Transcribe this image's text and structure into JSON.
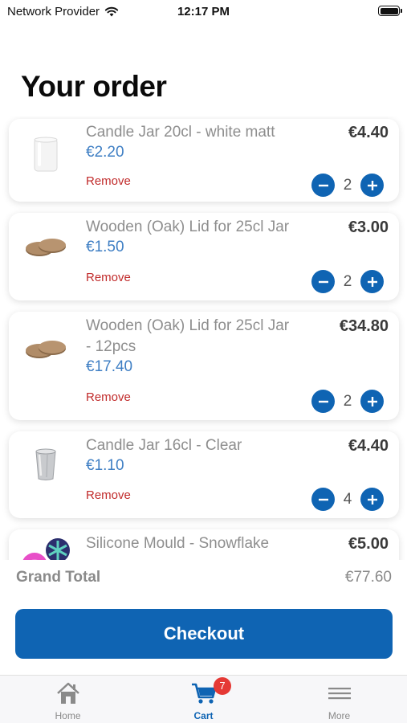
{
  "status": {
    "provider": "Network Provider",
    "time": "12:17 PM"
  },
  "title": "Your order",
  "items": [
    {
      "name": "Candle Jar 20cl - white matt",
      "unit_price": "€2.20",
      "total": "€4.40",
      "qty": "2",
      "remove": "Remove",
      "thumb": "white-jar"
    },
    {
      "name": "Wooden (Oak) Lid for 25cl Jar",
      "unit_price": "€1.50",
      "total": "€3.00",
      "qty": "2",
      "remove": "Remove",
      "thumb": "wooden-lid"
    },
    {
      "name_line1": "Wooden (Oak) Lid for 25cl Jar",
      "name_line2": "- 12pcs",
      "unit_price": "€17.40",
      "total": "€34.80",
      "qty": "2",
      "remove": "Remove",
      "thumb": "wooden-lid"
    },
    {
      "name": "Candle Jar 16cl - Clear",
      "unit_price": "€1.10",
      "total": "€4.40",
      "qty": "4",
      "remove": "Remove",
      "thumb": "clear-jar"
    },
    {
      "name": "Silicone Mould - Snowflake",
      "total": "€5.00",
      "thumb": "silicone-mould"
    }
  ],
  "grand_total": {
    "label": "Grand Total",
    "value": "€77.60"
  },
  "checkout_label": "Checkout",
  "tabs": [
    {
      "label": "Home",
      "icon": "home-icon"
    },
    {
      "label": "Cart",
      "icon": "cart-icon",
      "badge": "7",
      "active": true
    },
    {
      "label": "More",
      "icon": "menu-icon"
    }
  ],
  "colors": {
    "primary": "#0f64b3",
    "remove": "#c12b2b",
    "price": "#3f7fc4",
    "badge": "#e53935"
  }
}
